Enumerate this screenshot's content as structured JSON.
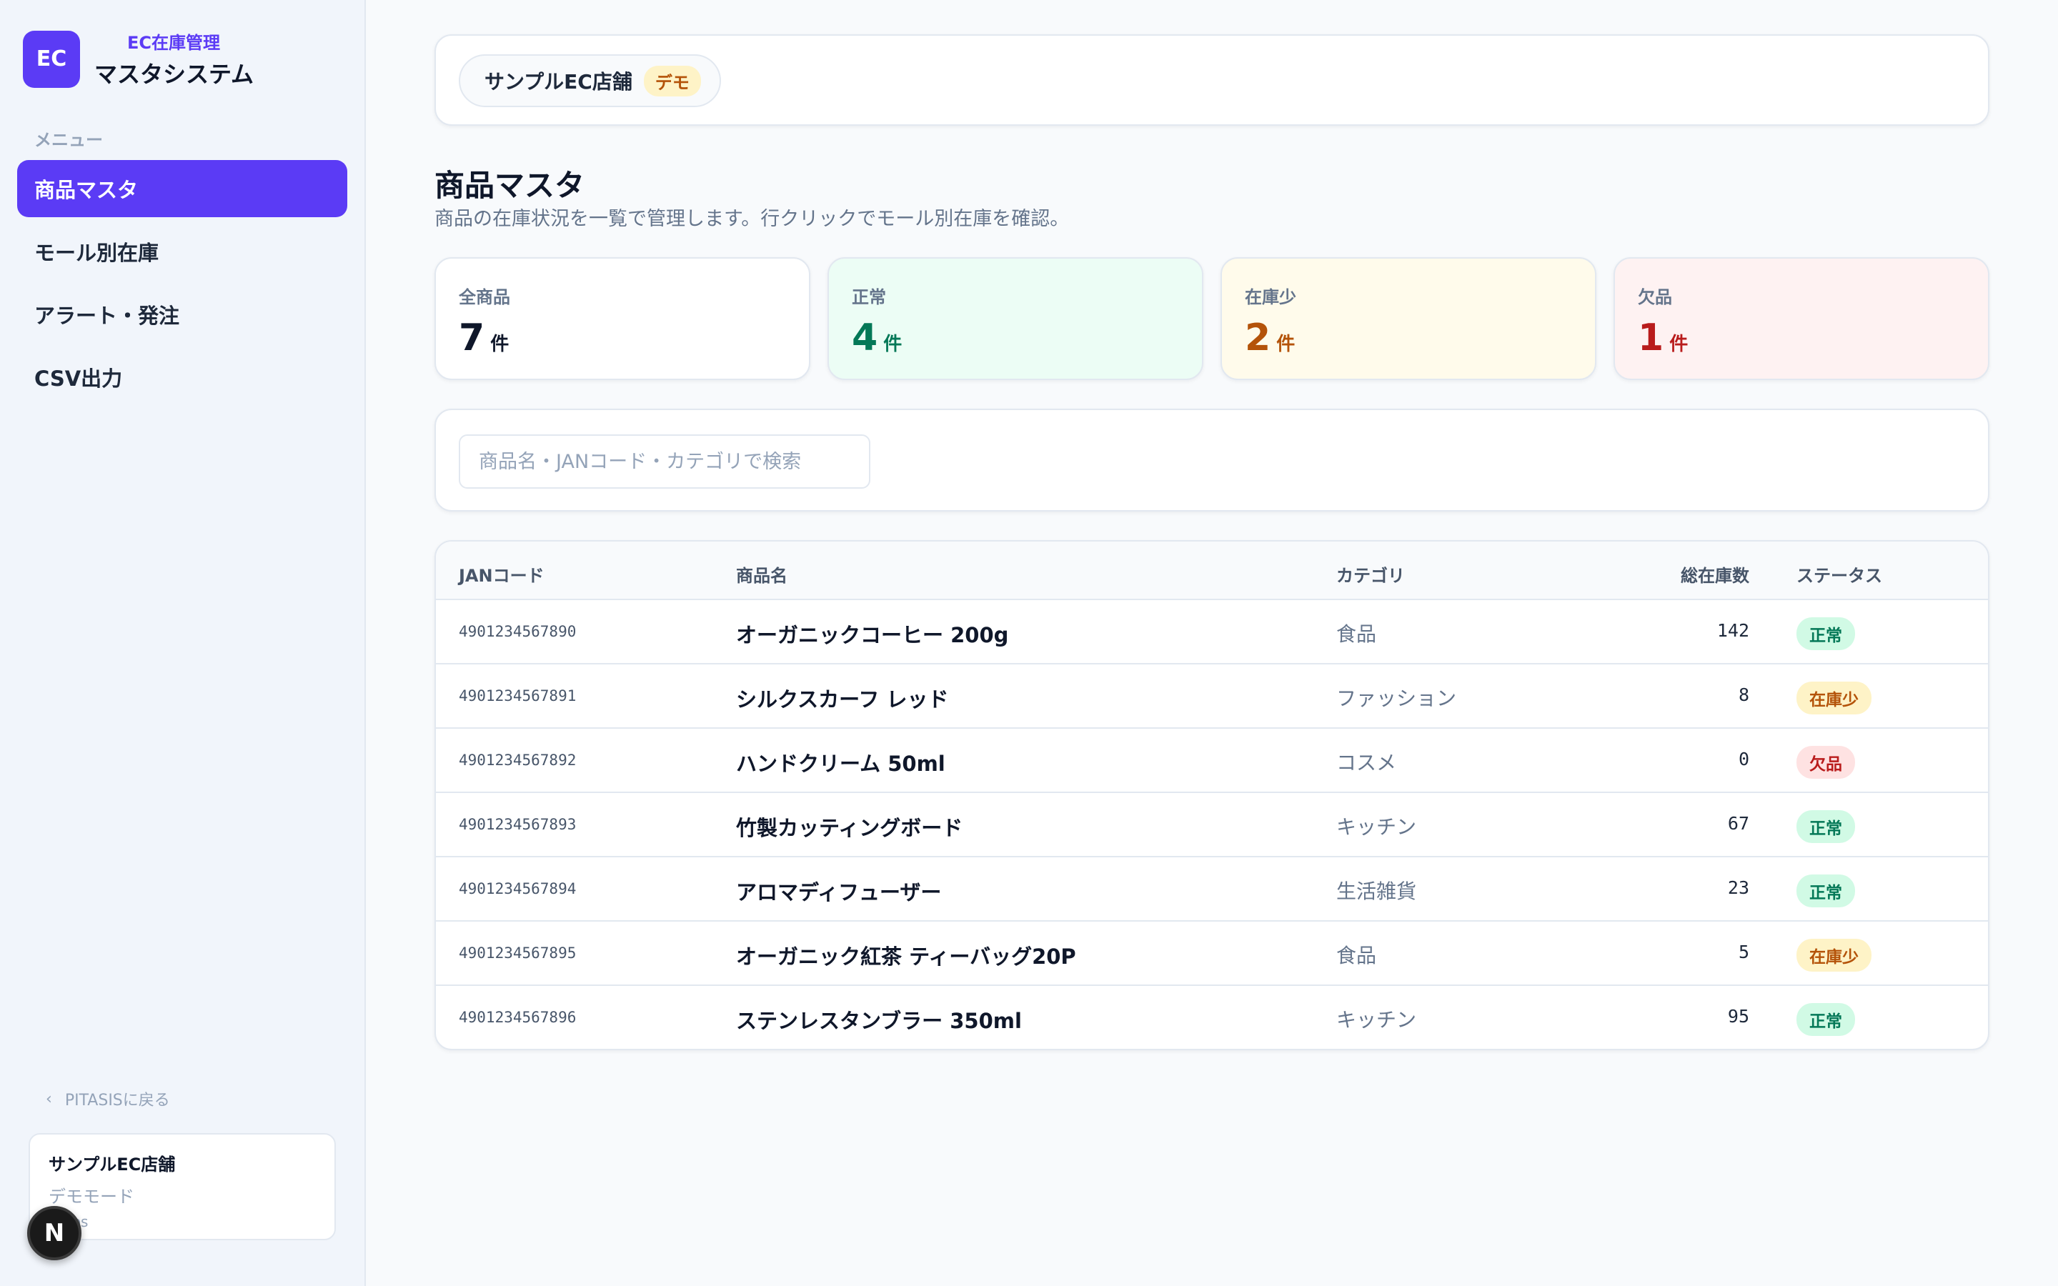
{
  "brand": {
    "logo": "EC",
    "subtitle": "EC在庫管理",
    "title": "マスタシステム"
  },
  "sidebar": {
    "menu_label": "メニュー",
    "items": [
      {
        "label": "商品マスタ",
        "active": true
      },
      {
        "label": "モール別在庫",
        "active": false
      },
      {
        "label": "アラート・発注",
        "active": false
      },
      {
        "label": "CSV出力",
        "active": false
      }
    ],
    "back_link": "PITASISに戻る",
    "store_card": {
      "name": "サンプルEC店舗",
      "mode": "デモモード",
      "user": "miros"
    },
    "badge": "N"
  },
  "topbar": {
    "store_name": "サンプルEC店舗",
    "demo_tag": "デモ"
  },
  "page": {
    "title": "商品マスタ",
    "description": "商品の在庫状況を一覧で管理します。行クリックでモール別在庫を確認。"
  },
  "stats": [
    {
      "label": "全商品",
      "value": "7",
      "unit": "件",
      "bg": "#ffffff",
      "color": "#0f172a"
    },
    {
      "label": "正常",
      "value": "4",
      "unit": "件",
      "bg": "#ecfdf5",
      "color": "#047857"
    },
    {
      "label": "在庫少",
      "value": "2",
      "unit": "件",
      "bg": "#fffbeb",
      "color": "#b45309"
    },
    {
      "label": "欠品",
      "value": "1",
      "unit": "件",
      "bg": "#fef2f2",
      "color": "#b91c1c"
    }
  ],
  "search": {
    "placeholder": "商品名・JANコード・カテゴリで検索",
    "value": ""
  },
  "table": {
    "headers": {
      "jan": "JANコード",
      "name": "商品名",
      "category": "カテゴリ",
      "stock": "総在庫数",
      "status": "ステータス"
    },
    "rows": [
      {
        "jan": "4901234567890",
        "name": "オーガニックコーヒー 200g",
        "category": "食品",
        "stock": "142",
        "status": "正常",
        "status_type": "ok"
      },
      {
        "jan": "4901234567891",
        "name": "シルクスカーフ レッド",
        "category": "ファッション",
        "stock": "8",
        "status": "在庫少",
        "status_type": "low"
      },
      {
        "jan": "4901234567892",
        "name": "ハンドクリーム 50ml",
        "category": "コスメ",
        "stock": "0",
        "status": "欠品",
        "status_type": "out"
      },
      {
        "jan": "4901234567893",
        "name": "竹製カッティングボード",
        "category": "キッチン",
        "stock": "67",
        "status": "正常",
        "status_type": "ok"
      },
      {
        "jan": "4901234567894",
        "name": "アロマディフューザー",
        "category": "生活雑貨",
        "stock": "23",
        "status": "正常",
        "status_type": "ok"
      },
      {
        "jan": "4901234567895",
        "name": "オーガニック紅茶 ティーバッグ20P",
        "category": "食品",
        "stock": "5",
        "status": "在庫少",
        "status_type": "low"
      },
      {
        "jan": "4901234567896",
        "name": "ステンレスタンブラー 350ml",
        "category": "キッチン",
        "stock": "95",
        "status": "正常",
        "status_type": "ok"
      }
    ]
  }
}
